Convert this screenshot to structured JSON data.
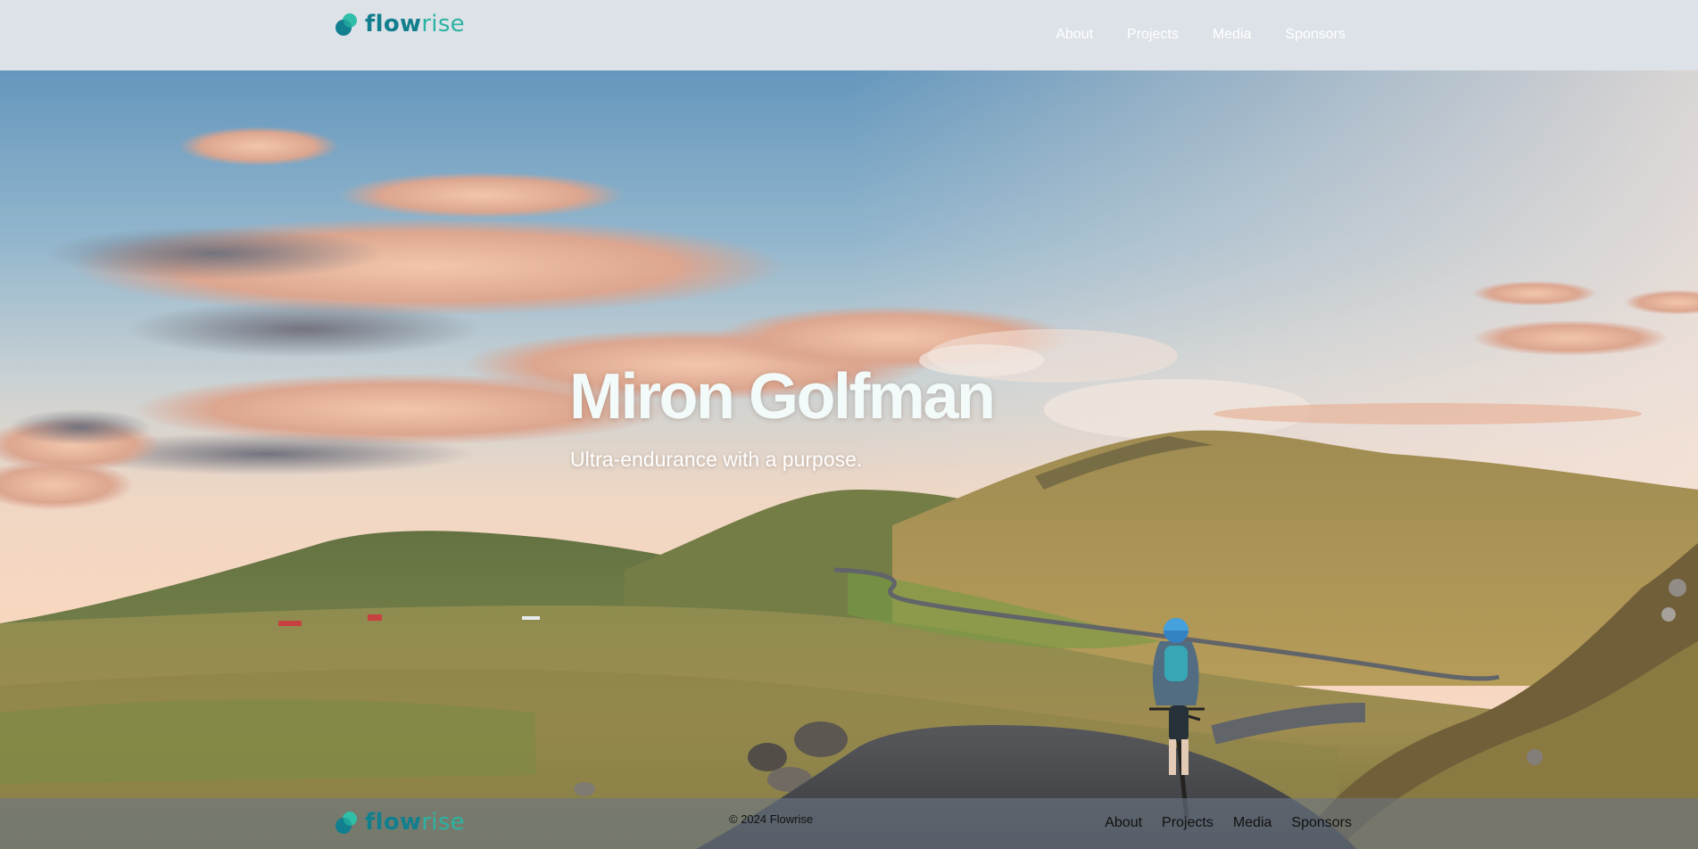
{
  "header": {
    "logo": {
      "text_part1": "flow",
      "text_part2": "rise",
      "icon": "flowrise-logo-icon"
    },
    "nav": [
      {
        "label": "About"
      },
      {
        "label": "Projects"
      },
      {
        "label": "Media"
      },
      {
        "label": "Sponsors"
      }
    ]
  },
  "hero": {
    "title": "Miron Golfman",
    "subtitle": "Ultra-endurance with a purpose.",
    "background": "landscape-photo-cyclist-on-mountain-road"
  },
  "footer": {
    "logo": {
      "text_part1": "flow",
      "text_part2": "rise",
      "icon": "flowrise-logo-icon"
    },
    "copyright": "© 2024 Flowrise",
    "nav": [
      {
        "label": "About"
      },
      {
        "label": "Projects"
      },
      {
        "label": "Media"
      },
      {
        "label": "Sponsors"
      }
    ]
  },
  "colors": {
    "brand_dark": "#127f8e",
    "brand_light": "#2ab3a2",
    "header_bg": "#dde2e8",
    "footer_bg": "#6b7684"
  }
}
